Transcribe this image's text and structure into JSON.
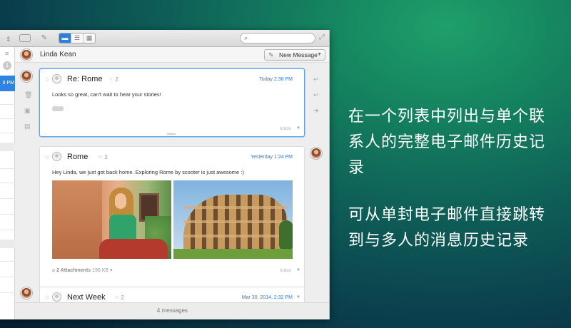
{
  "promo": {
    "line1": "在一个列表中列出与单个联系人的完整电子邮件历史记录",
    "line2": "可从单封电子邮件直接跳转到与多人的消息历史记录"
  },
  "toolbar": {
    "search_placeholder": "",
    "search_icon": "search-icon",
    "compose_icon": "compose-icon",
    "view_modes": [
      "conversation",
      "list",
      "grid"
    ]
  },
  "message_list": {
    "unread_count": "1",
    "selected_time_fragment": "6 PM"
  },
  "conversation": {
    "contact_name": "Linda Kean",
    "new_message_label": "New Message",
    "status": "4 messages",
    "messages": [
      {
        "subject": "Re: Rome",
        "participants": "2",
        "date": "Today 2:36 PM",
        "body": "Looks so great, can't wait to hear your stories!",
        "folder": "Inbox"
      },
      {
        "subject": "Rome",
        "participants": "2",
        "date": "Yesterday 1:24 PM",
        "body": "Hey Linda, we just got back home. Exploring Rome by scooter is just awesome :)",
        "attachments_label": "2 Attachments",
        "attachments_size": "196 KB",
        "folder": "Inbox"
      },
      {
        "subject": "Next Week",
        "participants": "2",
        "date": "Mar 30, 2014, 2:32 PM"
      }
    ]
  },
  "colors": {
    "accent": "#2f83e3",
    "date_blue": "#2f7ad8"
  }
}
